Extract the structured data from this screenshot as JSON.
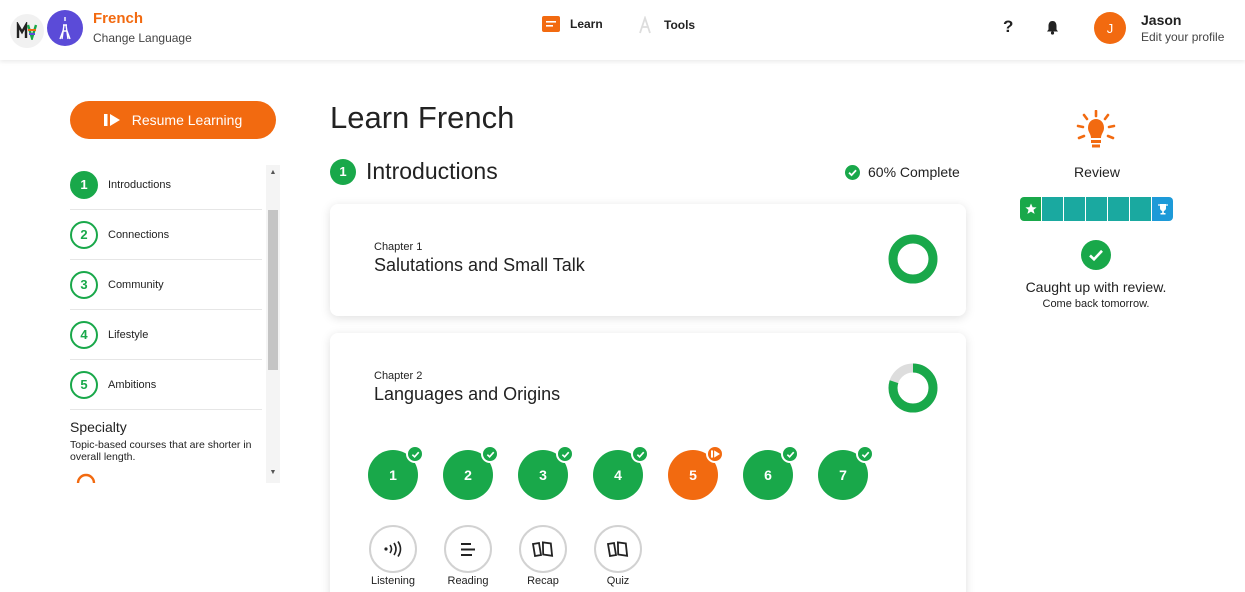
{
  "header": {
    "language": "French",
    "change_language": "Change Language",
    "nav": {
      "learn": "Learn",
      "tools": "Tools"
    },
    "help": "?",
    "user": {
      "initial": "J",
      "name": "Jason",
      "edit": "Edit your profile"
    }
  },
  "sidebar": {
    "resume": "Resume Learning",
    "units": [
      {
        "num": "1",
        "label": "Introductions",
        "active": true
      },
      {
        "num": "2",
        "label": "Connections"
      },
      {
        "num": "3",
        "label": "Community"
      },
      {
        "num": "4",
        "label": "Lifestyle"
      },
      {
        "num": "5",
        "label": "Ambitions"
      }
    ],
    "specialty_title": "Specialty",
    "specialty_desc": "Topic-based courses that are shorter in overall length."
  },
  "main": {
    "title": "Learn French",
    "unit_num": "1",
    "unit_title": "Introductions",
    "complete": "60% Complete",
    "chapters": [
      {
        "label": "Chapter 1",
        "title": "Salutations and Small Talk",
        "progress": 1.0
      },
      {
        "label": "Chapter 2",
        "title": "Languages and Origins",
        "progress": 0.8
      }
    ],
    "lessons": [
      {
        "num": "1",
        "status": "done"
      },
      {
        "num": "2",
        "status": "done"
      },
      {
        "num": "3",
        "status": "done"
      },
      {
        "num": "4",
        "status": "done"
      },
      {
        "num": "5",
        "status": "current"
      },
      {
        "num": "6",
        "status": "done"
      },
      {
        "num": "7",
        "status": "done"
      }
    ],
    "activities": [
      {
        "label": "Listening",
        "icon": "listening-icon"
      },
      {
        "label": "Reading",
        "icon": "reading-icon"
      },
      {
        "label": "Recap",
        "icon": "cards-icon"
      },
      {
        "label": "Quiz",
        "icon": "cards-icon"
      }
    ]
  },
  "review": {
    "title": "Review",
    "message": "Caught up with review.",
    "sub": "Come back tomorrow."
  },
  "colors": {
    "accent": "#f26a10",
    "green": "#19a84a",
    "teal": "#1aa9a0",
    "blue": "#1d9ad8",
    "purple": "#5b4bd8"
  }
}
